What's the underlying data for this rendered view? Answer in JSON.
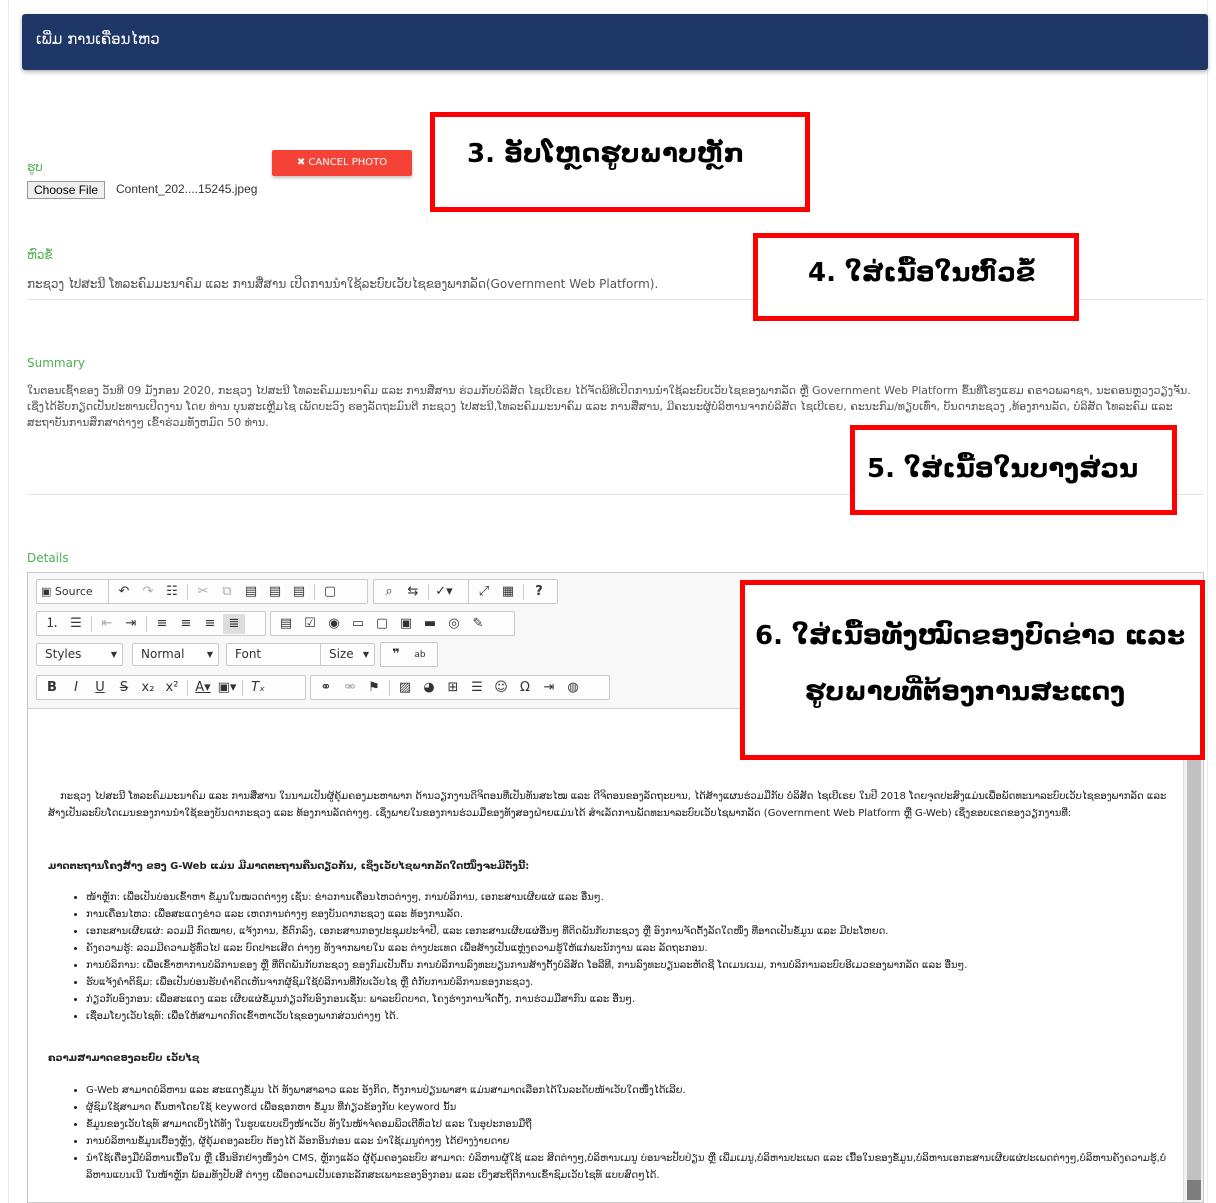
{
  "header": {
    "title": "ເພີ່ມ ການເຄື່ອນໄຫວ"
  },
  "photo": {
    "label": "ຮູບ",
    "choose_file": "Choose File",
    "file_name": "Content_202....15245.jpeg",
    "cancel_label": "✖ CANCEL PHOTO"
  },
  "title_field": {
    "label": "ຫົວຂໍ້",
    "value": "ກະຊວງ ໄປສະນີ ໂທລະຄົມມະນາຄົມ ແລະ ການສື່ສານ ເປີດການນຳໃຊ້ລະບົບເວັບໄຊຂອງພາກລັດ(Government Web Platform)."
  },
  "summary_field": {
    "label": "Summary",
    "value": "ໃນຕອນເຊົ້າຂອງ ວັນທີ 09 ມັງກອນ 2020, ກະຊວງ ໄປສະນີ ໂທລະຄົມມະນາຄົມ ແລະ ການສື່ສານ ຮ່ວມກັບບໍລິສັດ ໄຊເບີເຣຍ ໄດ້ຈັດພິທີເປີດການນຳໃຊ້ລະບົບເວັບໄຊຂອງພາກລັດ ຫຼື Government Web Platform ຂຶ້ນທີ່ໂຮງແຮມ ຄຣາວພລາຊາ, ນະຄອນຫຼວງວຽງຈັນ. ເຊິ່ງໄດ້ຮັບກຽດເປັນປະທານເປີດງານ ໂດຍ ທ່ານ ບຸນສະເຫຼີມໄຊ ເພັດບະວົງ ຮອງລັດຖະມົນຕີ ກະຊວງ ໄປສະນີ,ໂທລະຄົມມະນາຄົມ ແລະ ການສື່ສານ, ມີຄະນະຜູ້ບໍລິຫານຈາກບໍລິສັດ ໄຊເບີເຣຍ, ຄະນະກົມ/ທຽບເທົ່າ, ບັນດາກະຊວງ ,ທ້ອງການລັດ, ບໍລິສັດ ໂທລະຄົມ ແລະ ສະຖາບັນການສຶກສາຕ່າງໆ ເຂົ້າຮ່ວມທັງຫມົດ 50 ທ່ານ."
  },
  "details_field": {
    "label": "Details"
  },
  "toolbar": {
    "source": "Source",
    "styles": "Styles",
    "normal": "Normal",
    "font": "Font",
    "size": "Size"
  },
  "callouts": {
    "c3": "3.   ອັບໂຫຼດຮູບພາບຫຼັກ",
    "c4": "4.   ໃສ່ເນື້ອໃນຫົວຂໍ້",
    "c5": "5.   ໃສ່ເນື້ອໃນບາງສ່ວນ",
    "c6a": "6.   ໃສ່ເນື້ອທັງໝົດຂອງບົດຂ່າວ ແລະ",
    "c6b": "ຮູບພາບທີ່ຕ້ອງການສະແດງ"
  },
  "details_content": {
    "intro": "ກະຊວງ ໄປສະນີ ໂທລະຄົມມະນາຄົມ ແລະ ການສື່ສານ ໃນນາມເປັນຜູ້ຄຸ້ມຄອງມະຫາພາກ ດ້ານວຽກງານດິຈິຕອນທີ່ເປັນທັນສະໄໝ ແລະ ດີຈິຕອນຂອງລັດຖະບານ, ໄດ້ສ້າງແຜນຮ່ວມມືກັບ ບໍລິສັດ ໄຊເບີເຣຍ ໃນປີ 2018 ໂດຍຈຸດປະສົງແມ່ນເພື່ອພັດທະນາລະບົບເວັບໄຊຂອງພາກລັດ ແລະ ສ້າງເປັນລະບົບໂດເມນຂອງການນຳໃຊ້ຂອງບັນດາກະຊວງ ແລະ ທ້ອງການລັດຕ່າງໆ. ເຊິ່ງພາຍໃນຂອງການຮ່ວມມືຂອງທັງສອງຝ່າຍແມ່ນໄດ້ ສຳເລັດການພັດທະນາລະບົບເວັບໄຊພາກລັດ (Government Web Platform ຫຼື G-Web) ເຊິ່ງຂອບເຂດຂອງວຽກງານທີ່:",
    "heading1": "ມາດຕະຖານໂຄງສ້າງ ຂອງ G-Web ແມ່ນ ມີມາດຕະຖານຄືນດຽວກັນ, ເຊິ່ງເວັບໄຊພາກລັດໃດໜຶ່ງຈະມີດັ່ງນີ້:",
    "list1": [
      "ໜ້າຫຼັກ: ເພື່ອເປັນບ່ອນເຂົ້າຫາ ຂໍ້ມູນໃນໝວດຕ່າງໆ ເຊັ່ນ: ຂ່າວການເຄື່ອນໄຫວຕ່າງໆ, ການບໍລິການ, ເອກະສານເຜີຍແຜ່ ແລະ ອື່ນໆ.",
      "ການເຄື່ອນໄຫວ: ເພື່ອສະແດງຂ່າວ ແລະ ເຫດການຕ່າງໆ ຂອງບັນດາກະຊວງ ແລະ ທ້ອງການລັດ.",
      "ເອກະສານເຜີຍແຜ່: ລວມມີ ກົດໝາຍ, ແຈ້ງການ, ຂໍ້ຕົກລົງ, ເອກະສານກອງປະຊຸມປະຈຳປີ, ແລະ ເອກະສານເຜີຍແຜ່ອື່ນໆ ທີ່ຕິດພັນກັບກະຊວງ ຫຼື ອົງການຈັດຕັ້ງລັດໃດໜຶ່ງ ທີ່ອາດເປັນຂໍ້ມູນ ແລະ ມີປະໂຫຍດ.",
      "ຄັງຄວາມຮູ້: ລວມມີຄວາມຮູ້ທົ່ວໄປ ແລະ ບົດປາະເສີດ ຕ່າງໆ ທັງຈາກພາຍໃນ ແລະ ຕ່າງປະເທດ ເພື່ອສ້າງເປັນແຫຼ່ງຄວາມຮູ້ໃຫ້ແກ່ພະນັກງານ ແລະ ລັດຖະກອນ.",
      "ການບໍລິການ: ເພື່ອເຂົ້າຫາການບໍລິການຂອງ ຫຼື ທີ່ຕິດພັນກັບກະຊວງ ຂອງກົມເປັນຕົ້ນ ການບໍລິການລົງທະບຽນການສ້າງຕັ້ງບໍລິສັດ ໂອລີທີ, ການລົງທະບຽນລະຫັດຊີ ໂດເມນເນມ, ການບໍລິການລະບົບອີເມວຂອງພາກລັດ ແລະ ອື່ນໆ.",
      "ຮັບແຈ້ງຄຳຕິຊົມ: ເພື່ອເປັນບ່ອນຮັບຄຳຄິດເຫັນຈາກຜູ້ຊົມໃຊ້ບໍລິການທີ່ກັບເວັບໄຊ ຫຼື ຕໍ່ກັບການບໍລິການຂອງກະຊວງ.",
      "ກ່ຽວກັບອົງກອນ: ເພື່ອສະແດງ ແລະ ເຜີຍແຜ່ຂໍ້ມູນກ່ຽວກັບອົງກອນເຊັ່ນ: ພາລະບົດບາດ, ໂຄງຮ່າງການຈັດຕັ້ງ, ການຮ່ວມມືສາກົນ ແລະ ອື່ນໆ.",
      "ເຊື່ອມໂຍງເວັບໄຊທ໌: ເພື່ອໃຫ້ສາມາດກົດເຂົ້າຫາເວັບໄຊຂອງພາກສ່ວນຕ່າງໆ ໄດ້."
    ],
    "heading2": "ຄວາມສາມາດຂອງລະບົບ ເວັບໄຊ",
    "list2": [
      "G-Web ສາມາດບໍລິຫານ ແລະ ສະແດງຂໍ້ມູນ ໄດ້ ທັງພາສາລາວ ແລະ ອັງກິດ, ຕັ້ງການປ່ຽນພາສາ ແມ່ນສາມາດເລືອກໄດ້ໃນລະດັບໜ້າເວັບໃດໜຶ່ງໄດ້ເລີຍ.",
      "ຜູ້ຊົມໃຊ້ສາມາດ ຄົ້ນຫາໂດຍໃຊ້ keyword ເພື່ອຊອກຫາ ຂໍ້ມູນ ທີ່ກ່ຽວຂ້ອງກັບ keyword ນັ້ນ",
      "ຂໍ້ມູນຂອງເວັບໄຊທ໌ ສາມາດເບິ່ງໄດ້ທັງ ໃນຮູບແບບເບິ່ງໜ້າເວັບ ທັງໃນໜ້າຈໍຄອມພິວເຕີທົ່ວໄປ ແລະ ໃນອຸປະກອນມືຖື",
      "ການບໍລິຫານຂໍ້ມູນເບື້ອງຫຼັງ, ຜູ້ຄຸ້ມຄອງລະບົບ ຕ້ອງໄດ້ ລັອກອິນກ່ອນ ແລະ ນຳໃຊ້ເມນູຕ່າງໆ ໄດ້ຢ່າງງ່າຍດາຍ",
      "ນຳໃຊ້ເຄື່ອງມືບໍລິຫານເນື້ອໃນ ຫຼື ເອີ້ນອີກຢ່າງໜຶ່ງວ່າ CMS, ຫຼັກງແລ້ວ ຜູ້ຄຸ້ມຄອງລະບົບ ສາມາດ: ບໍລິຫານຜູ້ໃຊ້ ແລະ ສິດຕ່າງໆ,ບໍລິຫານເມນູ ບ່ອນຈະປັບປ່ຽນ ຫຼື ເພີ່ມເມນູ,ບໍລິຫານປະເພດ ແລະ ເນື້ອໃນຂອງຂໍ້ມູນ,ບໍລິຫານເອກະສານເຜີຍແຜ່ປະເພດຕ່າງໆ,ບໍລິຫານຄັງຄວາມຮູ້,ບໍລິຫານແບນເນີ ໃນໜ້າຫຼັກ ພ້ອມທັງປັບສີ ຕ່າງໆ ເພື່ອຄວາມເປັນເອກະລັກສະເພາະຂອງອົງກອນ ແລະ ເບິ່ງສະຖິຕິການເຂົ້າຊົມເວັບໄຊທ໌ ແບບສົດໆໄດ້."
    ]
  }
}
